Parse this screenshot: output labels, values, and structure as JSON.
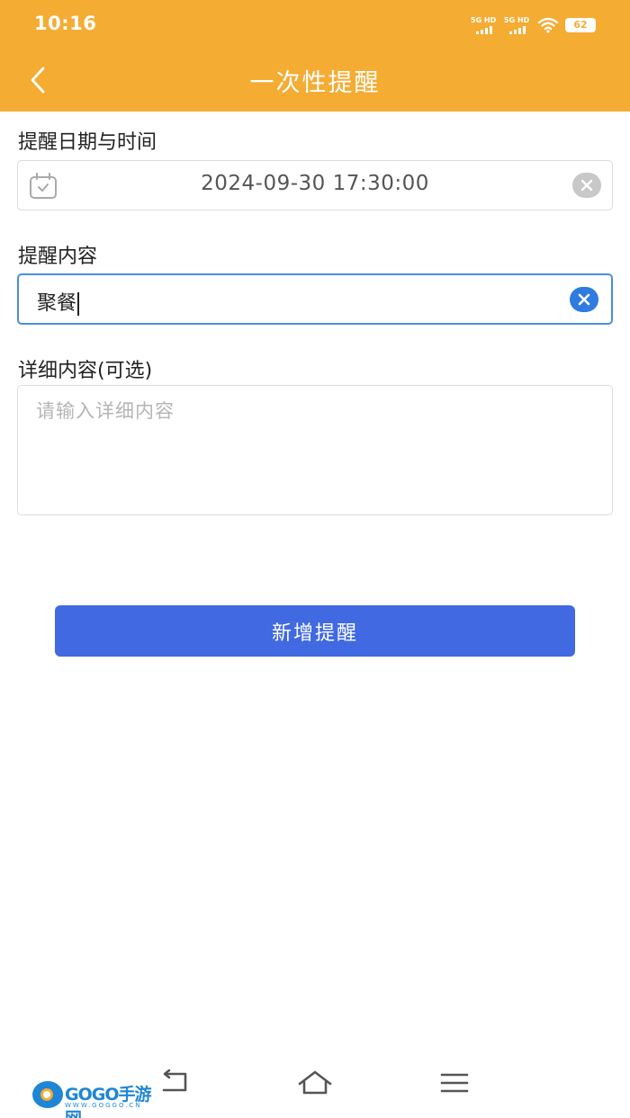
{
  "status_bar": {
    "time": "10:16",
    "signal_1": "5G HD",
    "signal_2": "5G HD",
    "battery": "62"
  },
  "header": {
    "title": "一次性提醒",
    "back_icon": "chevron-left-icon"
  },
  "form": {
    "datetime": {
      "label": "提醒日期与时间",
      "value": "2024-09-30 17:30:00",
      "icon": "calendar-icon"
    },
    "content": {
      "label": "提醒内容",
      "value": "聚餐"
    },
    "detail": {
      "label": "详细内容(可选)",
      "placeholder": "请输入详细内容"
    }
  },
  "submit_label": "新增提醒",
  "watermark": {
    "text": "GOGO手游网",
    "sub": "WWW.GOGGO.CN"
  },
  "colors": {
    "header": "#F4AC33",
    "primary_button": "#4169E1",
    "active_border": "#4A8FDC",
    "clear_active": "#2F7BE0"
  }
}
